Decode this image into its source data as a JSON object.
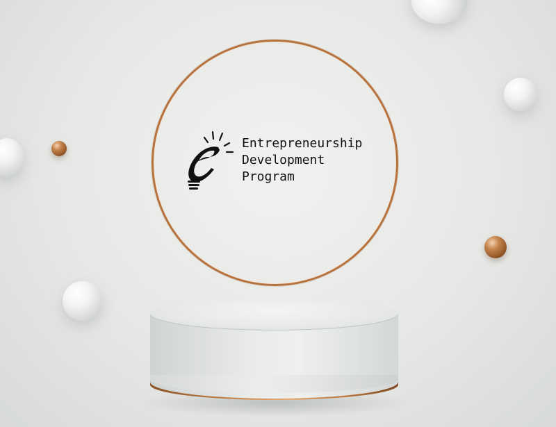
{
  "logo": {
    "icon": "lightbulb-e-icon",
    "line1": "Entrepreneurship",
    "line2": "Development",
    "line3": "Program"
  },
  "colors": {
    "background": "#e6e8e6",
    "bronze": "#b7733e",
    "text": "#111111"
  }
}
